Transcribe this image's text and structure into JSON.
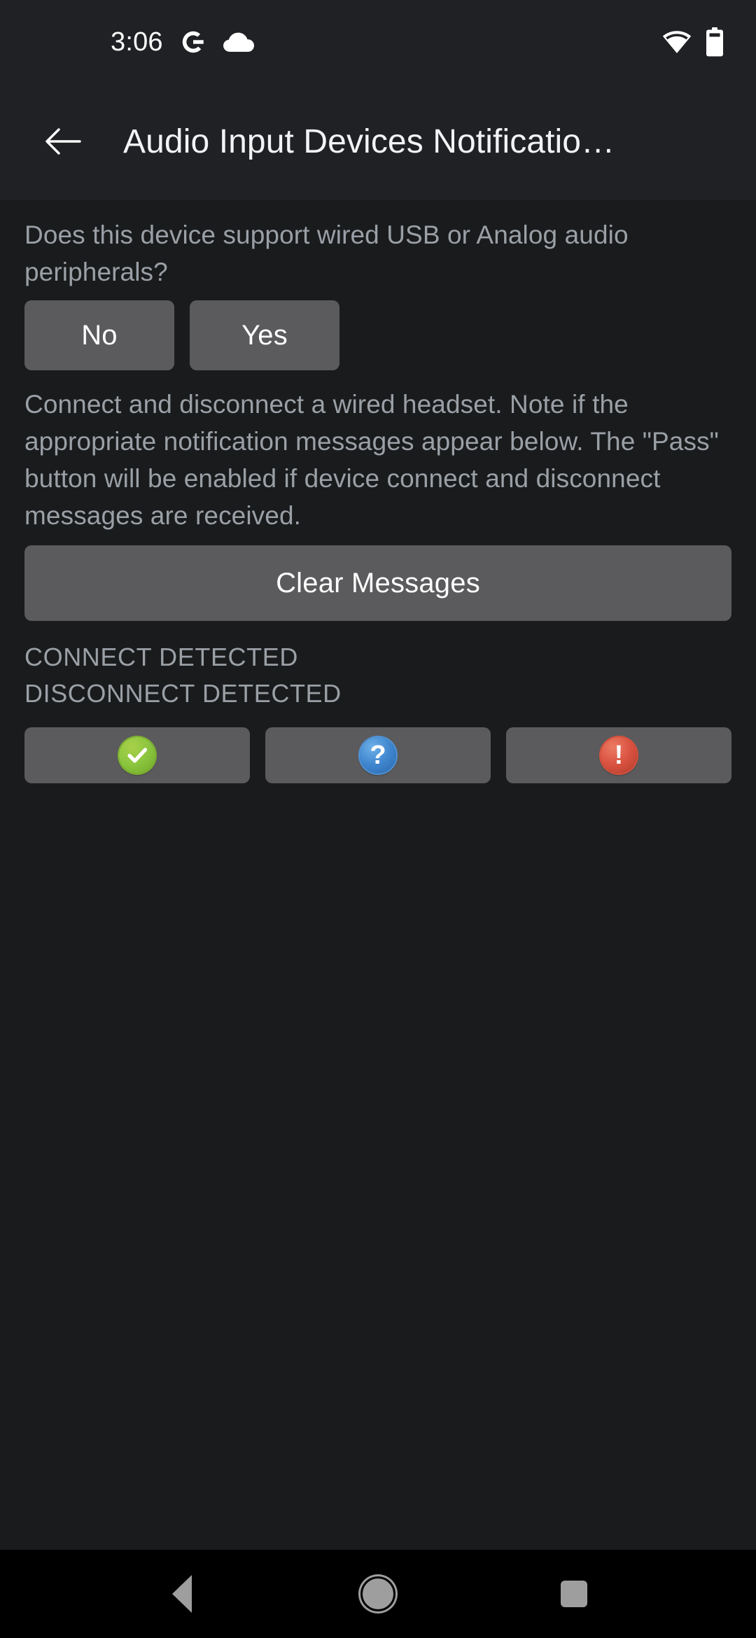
{
  "statusbar": {
    "clock": "3:06",
    "google_icon": "google-g-icon",
    "cloud_icon": "cloud-icon",
    "wifi_icon": "wifi-icon",
    "battery_icon": "battery-full-icon"
  },
  "appbar": {
    "back_icon": "arrow-back-icon",
    "title": "Audio Input Devices Notificatio…"
  },
  "main": {
    "question": "Does this device support wired USB or Analog audio peripherals?",
    "answers": [
      {
        "label": "No",
        "name": "no-button"
      },
      {
        "label": "Yes",
        "name": "yes-button"
      }
    ],
    "instructions": "Connect and disconnect a wired headset. Note if the appropriate notification messages appear below. The \"Pass\" button will be enabled if device connect and disconnect messages are received.",
    "clear_button": "Clear Messages",
    "status_lines": [
      "CONNECT DETECTED",
      "DISCONNECT DETECTED"
    ],
    "verdict_buttons": [
      {
        "name": "pass-button",
        "icon": "check-circle-icon",
        "glyph": "✔",
        "color": "#8cc63f"
      },
      {
        "name": "info-button",
        "icon": "question-circle-icon",
        "glyph": "?",
        "color": "#3f86cf"
      },
      {
        "name": "fail-button",
        "icon": "exclamation-circle-icon",
        "glyph": "!",
        "color": "#d95240"
      }
    ]
  },
  "navbar": {
    "back": "nav-back-icon",
    "home": "nav-home-icon",
    "recents": "nav-recents-icon"
  },
  "colors": {
    "background": "#1a1b1d",
    "appbar": "#202124",
    "button": "#5b5b5d",
    "secondary_text": "#9aa0a6",
    "primary_text": "#ffffff",
    "navbar": "#000000"
  }
}
